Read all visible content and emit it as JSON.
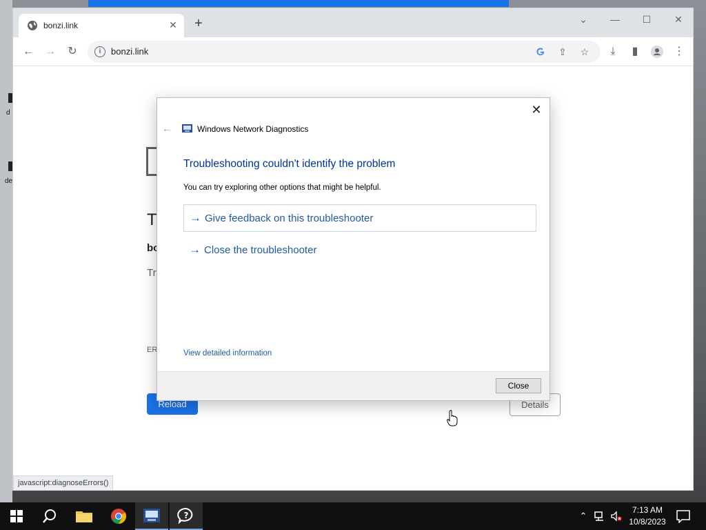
{
  "browser": {
    "tab_title": "bonzi.link",
    "tab_close": "✕",
    "new_tab": "+",
    "url": "bonzi.link",
    "status_text": "javascript:diagnoseErrors()"
  },
  "error_page": {
    "headline": "T",
    "bold_text": "bo",
    "try_text": "Try",
    "error_code": "ERI",
    "reload_label": "Reload",
    "details_label": "Details"
  },
  "desktop": {
    "frag1": "d",
    "frag2": "de"
  },
  "dialog": {
    "title": "Windows Network Diagnostics",
    "heading": "Troubleshooting couldn't identify the problem",
    "subtext": "You can try exploring other options that might be helpful.",
    "options": [
      {
        "label": "Give feedback on this troubleshooter"
      },
      {
        "label": "Close the troubleshooter"
      }
    ],
    "detail_link": "View detailed information",
    "close_button": "Close"
  },
  "taskbar": {
    "time": "7:13 AM",
    "date": "10/8/2023"
  },
  "colors": {
    "accent": "#1a73e8",
    "dialog_heading": "#003399",
    "dialog_link": "#1f5aa6"
  }
}
